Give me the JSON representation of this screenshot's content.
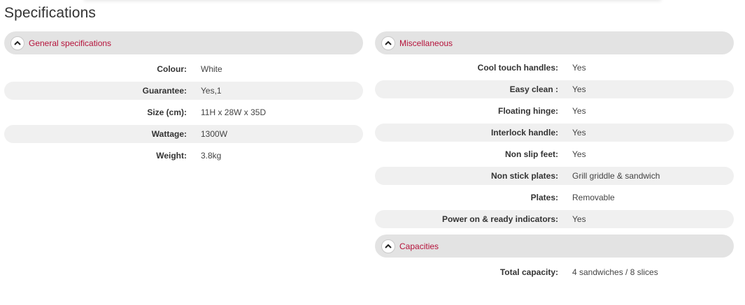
{
  "page": {
    "title": "Specifications"
  },
  "colors": {
    "section_title": "#b5123a",
    "header_bg": "#e3e3e3",
    "row_shade": "#f0f0f0"
  },
  "sections": {
    "general": {
      "title": "General specifications",
      "icon": "chevron-up-icon",
      "rows": [
        {
          "label": "Colour:",
          "value": "White"
        },
        {
          "label": "Guarantee:",
          "value": "Yes,1"
        },
        {
          "label": "Size (cm):",
          "value": "11H x 28W x 35D"
        },
        {
          "label": "Wattage:",
          "value": "1300W"
        },
        {
          "label": "Weight:",
          "value": "3.8kg"
        }
      ]
    },
    "misc": {
      "title": "Miscellaneous",
      "icon": "chevron-up-icon",
      "rows": [
        {
          "label": "Cool touch handles:",
          "value": "Yes"
        },
        {
          "label": "Easy clean :",
          "value": "Yes"
        },
        {
          "label": "Floating hinge:",
          "value": "Yes"
        },
        {
          "label": "Interlock handle:",
          "value": "Yes"
        },
        {
          "label": "Non slip feet:",
          "value": "Yes"
        },
        {
          "label": "Non stick plates:",
          "value": "Grill griddle & sandwich"
        },
        {
          "label": "Plates:",
          "value": "Removable"
        },
        {
          "label": "Power on & ready indicators:",
          "value": "Yes"
        }
      ]
    },
    "capacities": {
      "title": "Capacities",
      "icon": "chevron-up-icon",
      "rows": [
        {
          "label": "Total capacity:",
          "value": "4 sandwiches / 8 slices"
        }
      ]
    }
  }
}
